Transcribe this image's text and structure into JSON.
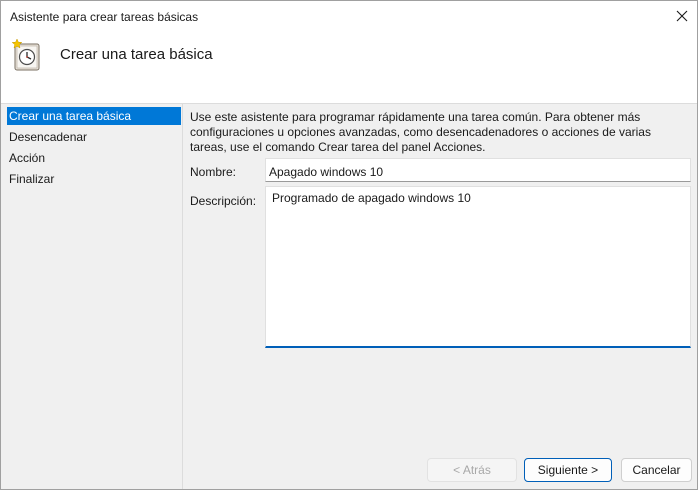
{
  "window": {
    "title": "Asistente para crear tareas básicas",
    "close_icon": "close-icon"
  },
  "header": {
    "title": "Crear una tarea básica",
    "icon": "task-scheduler-clock-icon"
  },
  "nav": {
    "items": [
      {
        "label": "Crear una tarea básica",
        "active": true
      },
      {
        "label": "Desencadenar",
        "active": false
      },
      {
        "label": "Acción",
        "active": false
      },
      {
        "label": "Finalizar",
        "active": false
      }
    ]
  },
  "form": {
    "intro": "Use este asistente para programar rápidamente una tarea común. Para obtener más configuraciones u opciones avanzadas, como desencadenadores o acciones de varias tareas, use el comando Crear tarea del panel Acciones.",
    "name_label": "Nombre:",
    "name_value": "Apagado windows 10",
    "description_label": "Descripción:",
    "description_value": "Programado de apagado windows 10"
  },
  "buttons": {
    "back": "< Atrás",
    "next": "Siguiente >",
    "cancel": "Cancelar"
  },
  "colors": {
    "accent": "#0078d7",
    "focus_border": "#005fb8"
  }
}
